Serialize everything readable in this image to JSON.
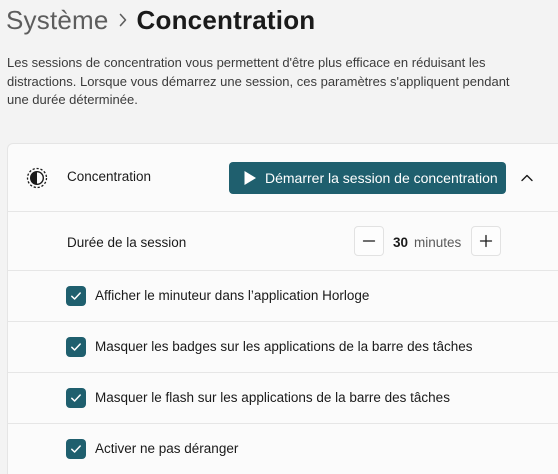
{
  "breadcrumb": {
    "parent": "Système",
    "current": "Concentration"
  },
  "description": "Les sessions de concentration vous permettent d'être plus efficace en réduisant les distractions. Lorsque vous démarrez une session, ces paramètres s'appliquent pendant une durée déterminée.",
  "focus_card": {
    "title": "Concentration",
    "start_button_label": "Démarrer la session de concentration",
    "expanded": true,
    "duration": {
      "label": "Durée de la session",
      "value": "30",
      "unit": "minutes"
    },
    "options": [
      {
        "label": "Afficher le minuteur dans l’application Horloge",
        "checked": true
      },
      {
        "label": "Masquer les badges sur les applications de la barre des tâches",
        "checked": true
      },
      {
        "label": "Masquer le flash sur les applications de la barre des tâches",
        "checked": true
      },
      {
        "label": "Activer ne pas déranger",
        "checked": true
      }
    ]
  },
  "colors": {
    "accent": "#1f5f6e",
    "background": "#f3f3f3",
    "card": "#fbfbfb"
  },
  "icons": {
    "breadcrumb_separator": "chevron-right-icon",
    "card_icon": "focus-icon",
    "start_button": "play-icon",
    "collapse": "chevron-up-icon",
    "decrease": "minus-icon",
    "increase": "plus-icon",
    "checkbox": "checkmark-icon"
  }
}
